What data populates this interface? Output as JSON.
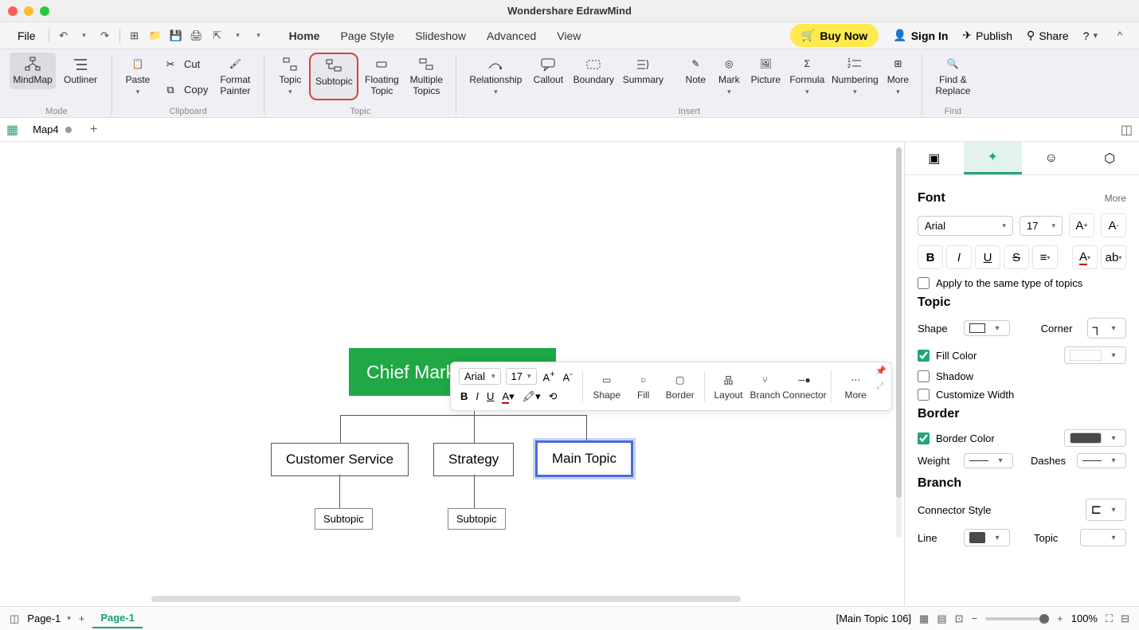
{
  "app_title": "Wondershare EdrawMind",
  "menubar": {
    "file": "File",
    "tabs": [
      "Home",
      "Page Style",
      "Slideshow",
      "Advanced",
      "View"
    ],
    "active_tab": "Home",
    "buy_now": "Buy Now",
    "sign_in": "Sign In",
    "publish": "Publish",
    "share": "Share"
  },
  "ribbon": {
    "mode": {
      "mindmap": "MindMap",
      "outliner": "Outliner",
      "label": "Mode"
    },
    "clipboard": {
      "paste": "Paste",
      "cut": "Cut",
      "copy": "Copy",
      "format_painter": "Format\nPainter",
      "label": "Clipboard"
    },
    "topic": {
      "topic": "Topic",
      "subtopic": "Subtopic",
      "floating": "Floating\nTopic",
      "multiple": "Multiple\nTopics",
      "label": "Topic"
    },
    "insert": {
      "relationship": "Relationship",
      "callout": "Callout",
      "boundary": "Boundary",
      "summary": "Summary",
      "note": "Note",
      "mark": "Mark",
      "picture": "Picture",
      "formula": "Formula",
      "numbering": "Numbering",
      "more": "More",
      "label": "Insert"
    },
    "find": {
      "find_replace": "Find &\nReplace",
      "label": "Find"
    }
  },
  "doc_tab": {
    "name": "Map4"
  },
  "canvas": {
    "root": "Chief Mark",
    "topics": [
      "Customer Service",
      "Strategy",
      "Main Topic"
    ],
    "subtopics": [
      "Subtopic",
      "Subtopic"
    ]
  },
  "mini_toolbar": {
    "font": "Arial",
    "size": "17",
    "buttons": {
      "shape": "Shape",
      "fill": "Fill",
      "border": "Border",
      "layout": "Layout",
      "branch": "Branch",
      "connector": "Connector",
      "more": "More"
    }
  },
  "side_panel": {
    "font": {
      "title": "Font",
      "more": "More",
      "family": "Arial",
      "size": "17",
      "apply_same": "Apply to the same type of topics"
    },
    "topic": {
      "title": "Topic",
      "shape": "Shape",
      "corner": "Corner",
      "fill_color": "Fill Color",
      "shadow": "Shadow",
      "customize_width": "Customize Width"
    },
    "border": {
      "title": "Border",
      "border_color": "Border Color",
      "weight": "Weight",
      "dashes": "Dashes"
    },
    "branch": {
      "title": "Branch",
      "connector_style": "Connector Style",
      "line": "Line",
      "topic": "Topic"
    }
  },
  "statusbar": {
    "page_label": "Page-1",
    "page_tab": "Page-1",
    "selection": "[Main Topic 106]",
    "zoom": "100%"
  }
}
